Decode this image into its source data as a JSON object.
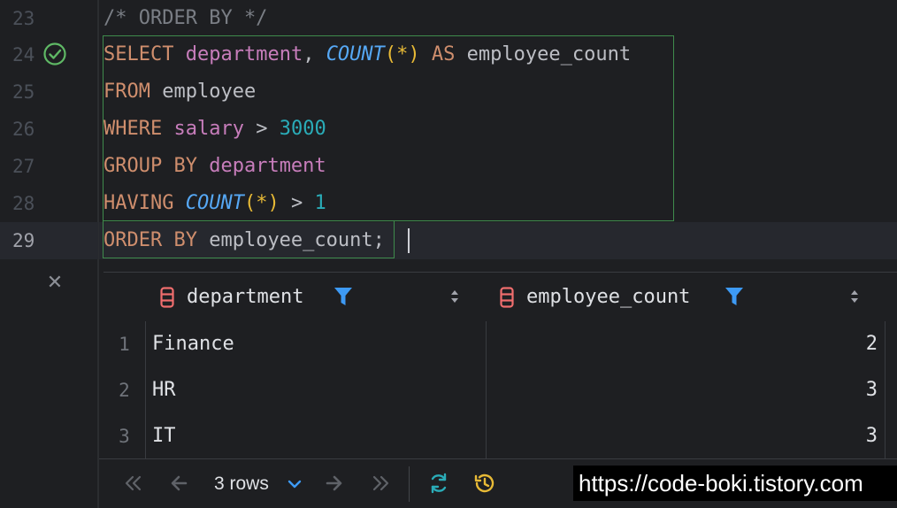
{
  "editor": {
    "line_numbers": [
      "23",
      "24",
      "25",
      "26",
      "27",
      "28",
      "29"
    ],
    "lines": {
      "l23": {
        "comment": "/* ORDER BY */"
      },
      "l24": {
        "k1": "SELECT",
        "c1": "department",
        "p1": ", ",
        "f1": "COUNT",
        "s1": "(*)",
        "sp": " ",
        "k2": "AS",
        "p2": " employee_count"
      },
      "l25": {
        "k1": "FROM",
        "p1": " employee"
      },
      "l26": {
        "k1": "WHERE",
        "sp": " ",
        "c1": "salary",
        "p1": " > ",
        "n1": "3000"
      },
      "l27": {
        "k1": "GROUP BY",
        "sp": " ",
        "c1": "department"
      },
      "l28": {
        "k1": "HAVING",
        "sp": " ",
        "f1": "COUNT",
        "s1": "(*)",
        "p1": " > ",
        "n1": "1"
      },
      "l29": {
        "k1": "ORDER BY",
        "p1": " employee_count;"
      }
    }
  },
  "results": {
    "columns": [
      {
        "label": "department"
      },
      {
        "label": "employee_count"
      }
    ],
    "rows": [
      {
        "num": "1",
        "department": "Finance",
        "count": "2"
      },
      {
        "num": "2",
        "department": "HR",
        "count": "3"
      },
      {
        "num": "3",
        "department": "IT",
        "count": "3"
      }
    ],
    "row_count_label": "3 rows"
  },
  "icons": {
    "check": "check-circle-icon",
    "close": "close-icon",
    "column": "database-column-icon",
    "filter": "filter-icon",
    "sort": "sort-icon",
    "first": "first-page-icon",
    "prev": "previous-page-icon",
    "next": "next-page-icon",
    "last": "last-page-icon",
    "refresh": "refresh-icon",
    "history": "history-icon"
  },
  "colors": {
    "keyword": "#cf8e6d",
    "column": "#c77dbb",
    "function": "#56a8f5",
    "number": "#2aacb8",
    "selection_border": "#3f8b4c",
    "success": "#5fb865",
    "column_icon": "#f06e6e"
  },
  "watermark": "https://code-boki.tistory.com"
}
